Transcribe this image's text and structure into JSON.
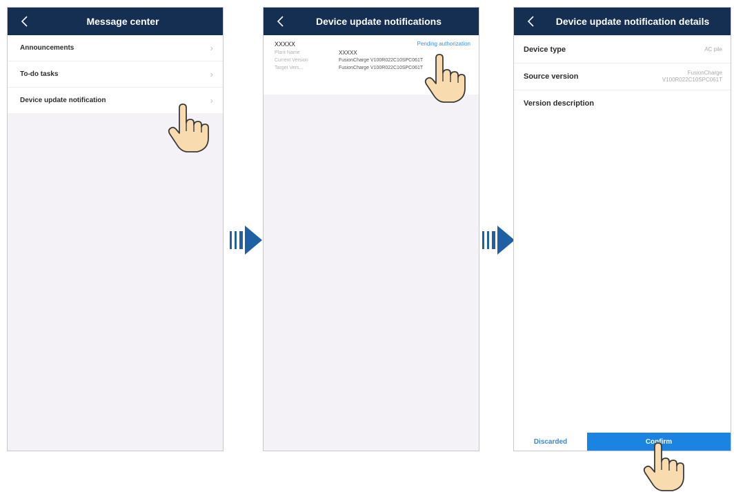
{
  "screen1": {
    "title": "Message center",
    "items": [
      {
        "label": "Announcements"
      },
      {
        "label": "To-do tasks"
      },
      {
        "label": "Device update notification"
      }
    ]
  },
  "screen2": {
    "title": "Device update notifications",
    "card": {
      "id": "XXXXX",
      "status": "Pending authorization",
      "plant_name_label": "Plant Name",
      "plant_name": "XXXXX",
      "current_version_label": "Current Version",
      "current_version": "FusionCharge V100R022C10SPC061T",
      "target_version_label": "Target Vers...",
      "target_version": "FusionCharge V100R022C10SPC061T"
    }
  },
  "screen3": {
    "title": "Device update notification details",
    "device_type_label": "Device type",
    "device_type": "AC pile",
    "source_version_label": "Source version",
    "source_version_line1": "FusionCharge",
    "source_version_line2": "V100R022C10SPC061T",
    "version_description_label": "Version description",
    "discard_label": "Discarded",
    "confirm_label": "Confirm"
  },
  "icons": {
    "back": "chevron-left-icon",
    "chevron": "chevron-right-icon",
    "hand": "pointing-hand-icon",
    "next": "next-step-arrow-icon"
  },
  "colors": {
    "header": "#152f52",
    "accent": "#1b83e2",
    "arrow": "#1f5fa3",
    "hand": "#f9dbb0"
  }
}
